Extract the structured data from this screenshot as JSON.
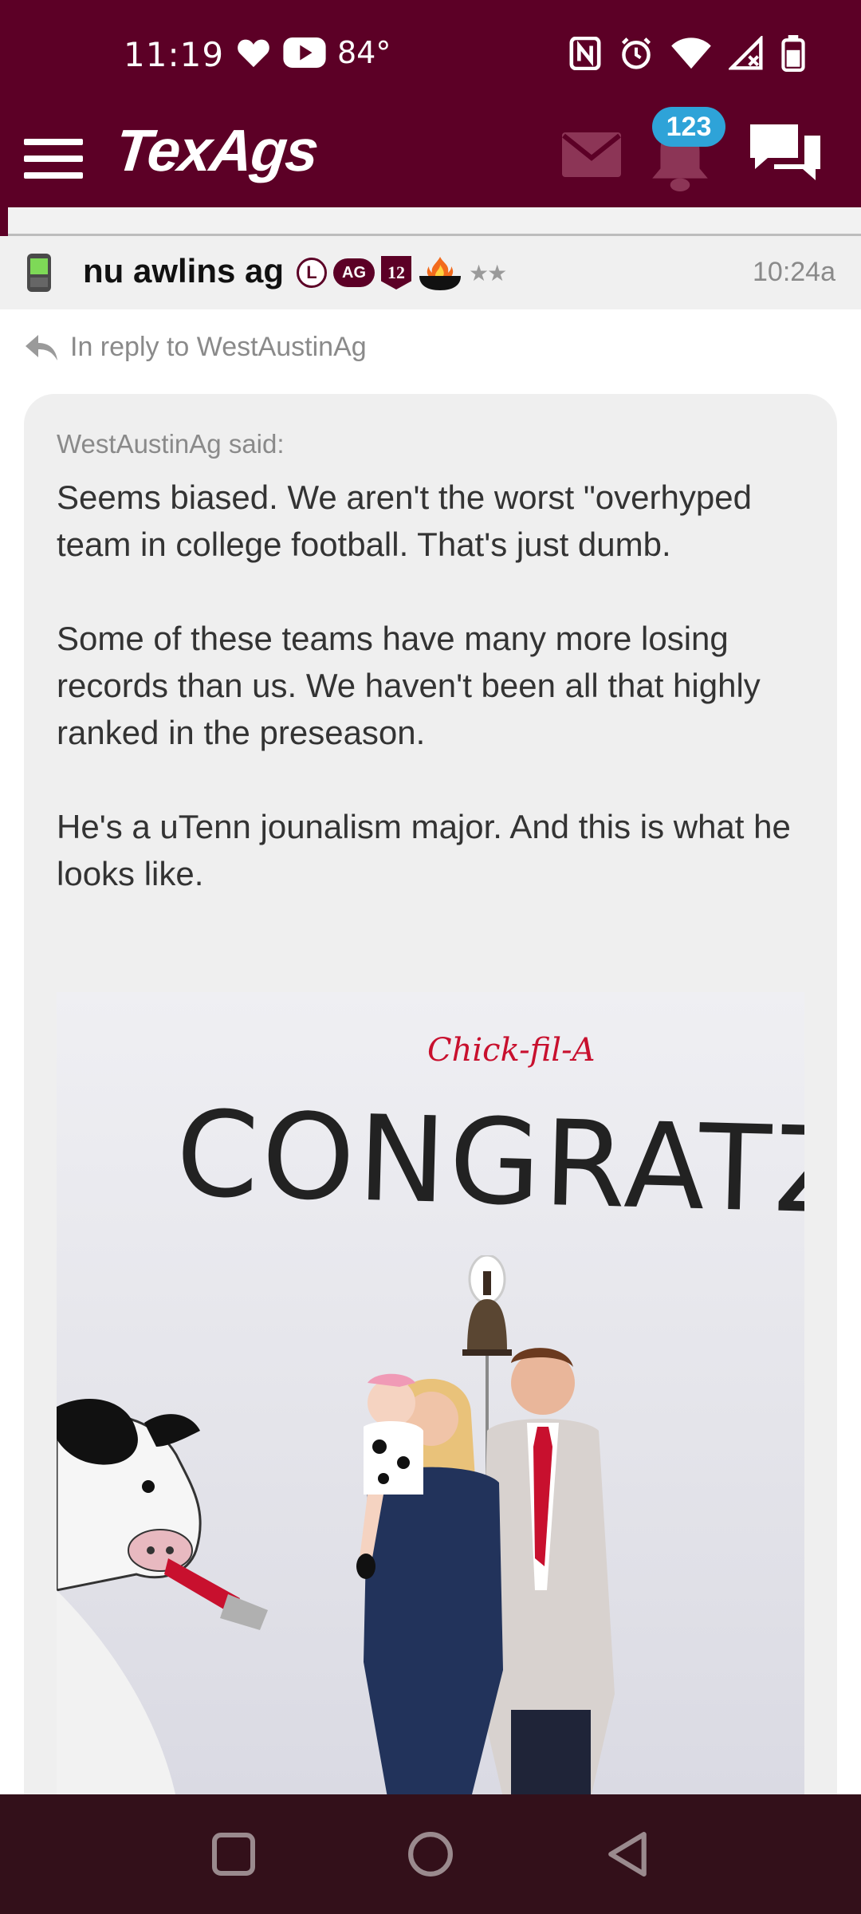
{
  "status_bar": {
    "time": "11:19",
    "temperature": "84°",
    "icons": [
      "heart-icon",
      "youtube-icon",
      "nfc-icon",
      "alarm-icon",
      "wifi-icon",
      "signal-icon",
      "battery-icon"
    ]
  },
  "app_header": {
    "logo": "TexAgs",
    "notification_count": "123",
    "brand_color": "#5c0026",
    "badge_color": "#2ea3d8"
  },
  "post": {
    "username": "nu awlins ag",
    "badges": {
      "l_label": "L",
      "ag_label": "AG",
      "twelve_label": "12"
    },
    "stars": "★★",
    "time": "10:24a",
    "reply_to": "In reply to WestAustinAg",
    "quote": {
      "attribution": "WestAustinAg said:",
      "body": "Seems biased. We aren't the worst \"overhyped team in college football. That's just dumb.\n\nSome of these teams have many more losing records than us. We haven't been all that highly ranked in the preseason.\n\nHe's a uTenn jounalism major. And this is what he looks like."
    },
    "photo": {
      "brand_text": "Chick-fil-A",
      "wall_text": "CONGRATZ"
    }
  }
}
